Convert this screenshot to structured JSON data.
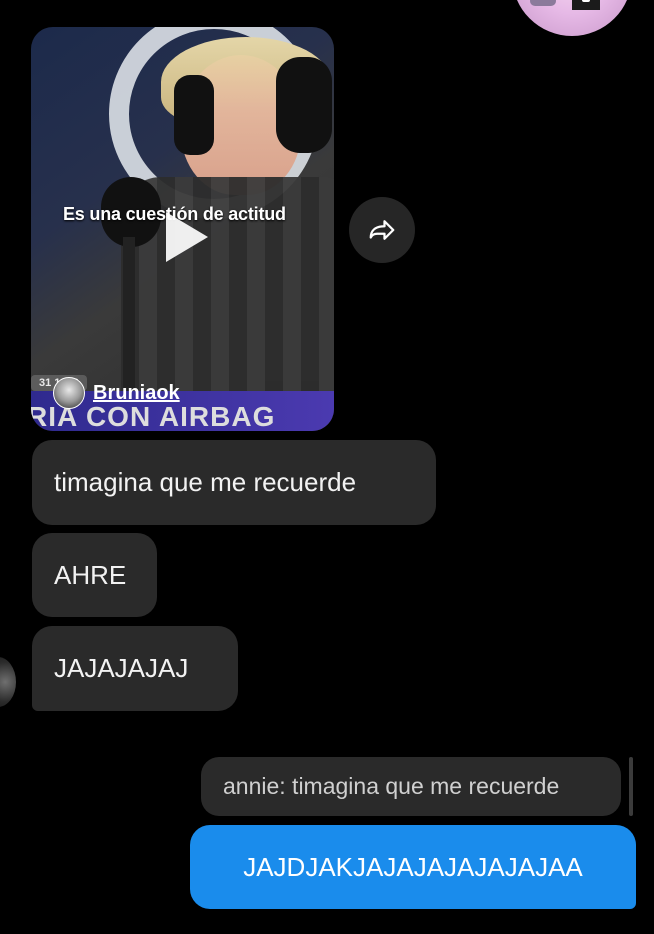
{
  "video": {
    "caption": "Es una cuestión de actitud",
    "username": "Bruniaok",
    "counter": "31 1243",
    "banner_text": "RIA CON AIRBAG"
  },
  "messages": {
    "incoming": [
      "timagina que me recuerde",
      "AHRE",
      "JAJAJAJAJ"
    ],
    "reply_quote": "annie: timagina que me recuerde",
    "outgoing": "JAJDJAKJAJAJAJAJAJAJAA"
  },
  "colors": {
    "background": "#000000",
    "incoming_bubble": "#2a2a2a",
    "outgoing_bubble": "#1a8cec"
  },
  "icons": {
    "share": "share-arrow-icon",
    "play": "play-icon"
  }
}
